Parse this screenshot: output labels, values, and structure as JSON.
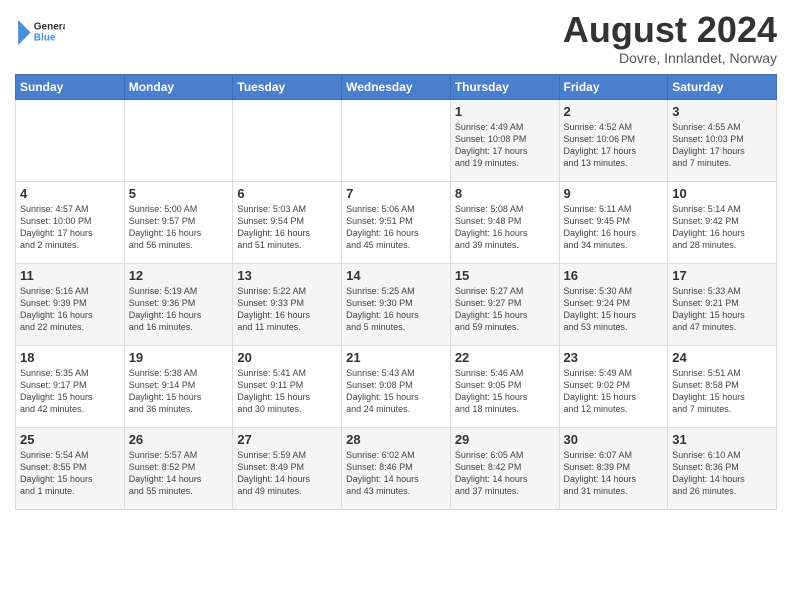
{
  "logo": {
    "general": "General",
    "blue": "Blue"
  },
  "title": "August 2024",
  "subtitle": "Dovre, Innlandet, Norway",
  "days_header": [
    "Sunday",
    "Monday",
    "Tuesday",
    "Wednesday",
    "Thursday",
    "Friday",
    "Saturday"
  ],
  "weeks": [
    [
      {
        "day": "",
        "content": ""
      },
      {
        "day": "",
        "content": ""
      },
      {
        "day": "",
        "content": ""
      },
      {
        "day": "",
        "content": ""
      },
      {
        "day": "1",
        "content": "Sunrise: 4:49 AM\nSunset: 10:08 PM\nDaylight: 17 hours\nand 19 minutes."
      },
      {
        "day": "2",
        "content": "Sunrise: 4:52 AM\nSunset: 10:06 PM\nDaylight: 17 hours\nand 13 minutes."
      },
      {
        "day": "3",
        "content": "Sunrise: 4:55 AM\nSunset: 10:03 PM\nDaylight: 17 hours\nand 7 minutes."
      }
    ],
    [
      {
        "day": "4",
        "content": "Sunrise: 4:57 AM\nSunset: 10:00 PM\nDaylight: 17 hours\nand 2 minutes."
      },
      {
        "day": "5",
        "content": "Sunrise: 5:00 AM\nSunset: 9:57 PM\nDaylight: 16 hours\nand 56 minutes."
      },
      {
        "day": "6",
        "content": "Sunrise: 5:03 AM\nSunset: 9:54 PM\nDaylight: 16 hours\nand 51 minutes."
      },
      {
        "day": "7",
        "content": "Sunrise: 5:06 AM\nSunset: 9:51 PM\nDaylight: 16 hours\nand 45 minutes."
      },
      {
        "day": "8",
        "content": "Sunrise: 5:08 AM\nSunset: 9:48 PM\nDaylight: 16 hours\nand 39 minutes."
      },
      {
        "day": "9",
        "content": "Sunrise: 5:11 AM\nSunset: 9:45 PM\nDaylight: 16 hours\nand 34 minutes."
      },
      {
        "day": "10",
        "content": "Sunrise: 5:14 AM\nSunset: 9:42 PM\nDaylight: 16 hours\nand 28 minutes."
      }
    ],
    [
      {
        "day": "11",
        "content": "Sunrise: 5:16 AM\nSunset: 9:39 PM\nDaylight: 16 hours\nand 22 minutes."
      },
      {
        "day": "12",
        "content": "Sunrise: 5:19 AM\nSunset: 9:36 PM\nDaylight: 16 hours\nand 16 minutes."
      },
      {
        "day": "13",
        "content": "Sunrise: 5:22 AM\nSunset: 9:33 PM\nDaylight: 16 hours\nand 11 minutes."
      },
      {
        "day": "14",
        "content": "Sunrise: 5:25 AM\nSunset: 9:30 PM\nDaylight: 16 hours\nand 5 minutes."
      },
      {
        "day": "15",
        "content": "Sunrise: 5:27 AM\nSunset: 9:27 PM\nDaylight: 15 hours\nand 59 minutes."
      },
      {
        "day": "16",
        "content": "Sunrise: 5:30 AM\nSunset: 9:24 PM\nDaylight: 15 hours\nand 53 minutes."
      },
      {
        "day": "17",
        "content": "Sunrise: 5:33 AM\nSunset: 9:21 PM\nDaylight: 15 hours\nand 47 minutes."
      }
    ],
    [
      {
        "day": "18",
        "content": "Sunrise: 5:35 AM\nSunset: 9:17 PM\nDaylight: 15 hours\nand 42 minutes."
      },
      {
        "day": "19",
        "content": "Sunrise: 5:38 AM\nSunset: 9:14 PM\nDaylight: 15 hours\nand 36 minutes."
      },
      {
        "day": "20",
        "content": "Sunrise: 5:41 AM\nSunset: 9:11 PM\nDaylight: 15 hours\nand 30 minutes."
      },
      {
        "day": "21",
        "content": "Sunrise: 5:43 AM\nSunset: 9:08 PM\nDaylight: 15 hours\nand 24 minutes."
      },
      {
        "day": "22",
        "content": "Sunrise: 5:46 AM\nSunset: 9:05 PM\nDaylight: 15 hours\nand 18 minutes."
      },
      {
        "day": "23",
        "content": "Sunrise: 5:49 AM\nSunset: 9:02 PM\nDaylight: 15 hours\nand 12 minutes."
      },
      {
        "day": "24",
        "content": "Sunrise: 5:51 AM\nSunset: 8:58 PM\nDaylight: 15 hours\nand 7 minutes."
      }
    ],
    [
      {
        "day": "25",
        "content": "Sunrise: 5:54 AM\nSunset: 8:55 PM\nDaylight: 15 hours\nand 1 minute."
      },
      {
        "day": "26",
        "content": "Sunrise: 5:57 AM\nSunset: 8:52 PM\nDaylight: 14 hours\nand 55 minutes."
      },
      {
        "day": "27",
        "content": "Sunrise: 5:59 AM\nSunset: 8:49 PM\nDaylight: 14 hours\nand 49 minutes."
      },
      {
        "day": "28",
        "content": "Sunrise: 6:02 AM\nSunset: 8:46 PM\nDaylight: 14 hours\nand 43 minutes."
      },
      {
        "day": "29",
        "content": "Sunrise: 6:05 AM\nSunset: 8:42 PM\nDaylight: 14 hours\nand 37 minutes."
      },
      {
        "day": "30",
        "content": "Sunrise: 6:07 AM\nSunset: 8:39 PM\nDaylight: 14 hours\nand 31 minutes."
      },
      {
        "day": "31",
        "content": "Sunrise: 6:10 AM\nSunset: 8:36 PM\nDaylight: 14 hours\nand 26 minutes."
      }
    ]
  ]
}
